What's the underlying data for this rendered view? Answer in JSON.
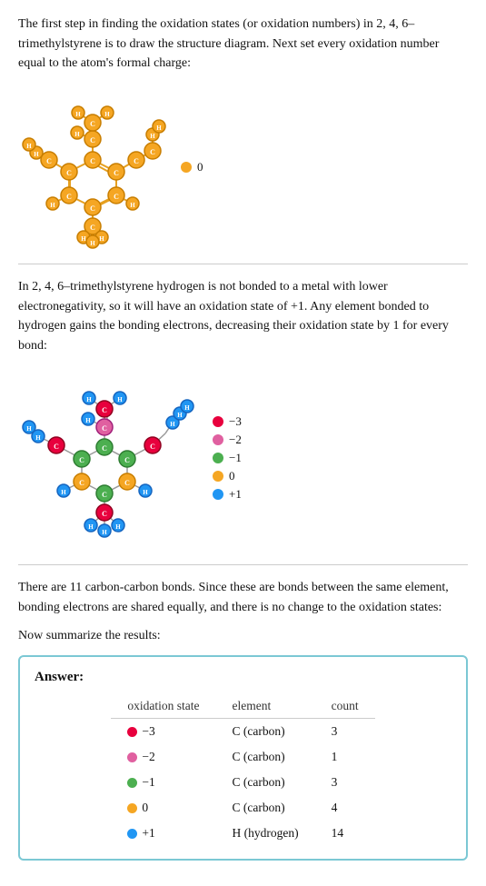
{
  "sections": [
    {
      "id": "section1",
      "text": "The first step in finding the oxidation states (or oxidation numbers) in 2, 4, 6–trimethylstyrene is to draw the structure diagram. Next set every oxidation number equal to the atom's formal charge:",
      "legend": [
        {
          "color": "#f5a623",
          "label": "0"
        }
      ]
    },
    {
      "id": "section2",
      "text": "In 2, 4, 6–trimethylstyrene hydrogen is not bonded to a metal with lower electronegativity, so it will have an oxidation state of +1. Any element bonded to hydrogen gains the bonding electrons, decreasing their oxidation state by 1 for every bond:",
      "legend": [
        {
          "color": "#e8003d",
          "label": "−3"
        },
        {
          "color": "#e060a0",
          "label": "−2"
        },
        {
          "color": "#4caf50",
          "label": "−1"
        },
        {
          "color": "#f5a623",
          "label": "0"
        },
        {
          "color": "#2196f3",
          "label": "+1"
        }
      ]
    },
    {
      "id": "section3",
      "text1": "There are 11 carbon-carbon bonds.  Since these are bonds between the same element, bonding electrons are shared equally, and there is no change to the oxidation states:",
      "text2": "Now summarize the results:"
    }
  ],
  "answer": {
    "label": "Answer:",
    "columns": [
      "oxidation state",
      "element",
      "count"
    ],
    "rows": [
      {
        "dot": "#e8003d",
        "state": "−3",
        "element": "C (carbon)",
        "count": "3"
      },
      {
        "dot": "#e060a0",
        "state": "−2",
        "element": "C (carbon)",
        "count": "1"
      },
      {
        "dot": "#4caf50",
        "state": "−1",
        "element": "C (carbon)",
        "count": "3"
      },
      {
        "dot": "#f5a623",
        "state": "0",
        "element": "C (carbon)",
        "count": "4"
      },
      {
        "dot": "#2196f3",
        "state": "+1",
        "element": "H (hydrogen)",
        "count": "14"
      }
    ]
  }
}
